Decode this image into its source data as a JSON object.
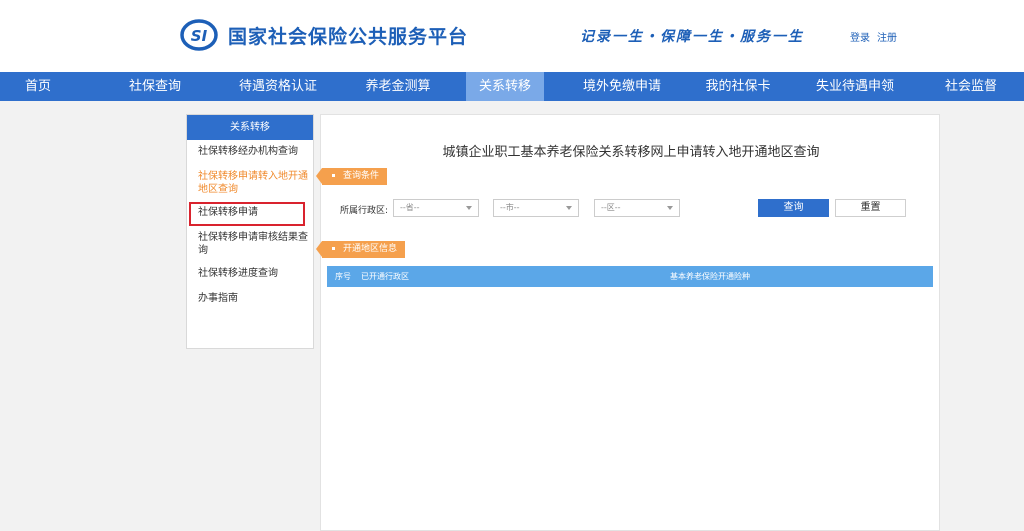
{
  "header": {
    "logo_text": "SI",
    "site_title": "国家社会保险公共服务平台",
    "slogan": "记录一生・保障一生・服务一生",
    "login": "登录",
    "register": "注册"
  },
  "nav": {
    "items": [
      {
        "label": "首页"
      },
      {
        "label": "社保查询"
      },
      {
        "label": "待遇资格认证"
      },
      {
        "label": "养老金测算"
      },
      {
        "label": "关系转移"
      },
      {
        "label": "境外免缴申请"
      },
      {
        "label": "我的社保卡"
      },
      {
        "label": "失业待遇申领"
      },
      {
        "label": "社会监督"
      }
    ],
    "active": "关系转移"
  },
  "sidebar": {
    "title": "关系转移",
    "items": [
      {
        "label": "社保转移经办机构查询"
      },
      {
        "label": "社保转移申请转入地开通地区查询"
      },
      {
        "label": "社保转移申请"
      },
      {
        "label": "社保转移申请审核结果查询"
      },
      {
        "label": "社保转移进度查询"
      },
      {
        "label": "办事指南"
      }
    ]
  },
  "main": {
    "title": "城镇企业职工基本养老保险关系转移网上申请转入地开通地区查询",
    "query_section": "查询条件",
    "region_label": "所属行政区:",
    "province_placeholder": "--省--",
    "city_placeholder": "--市--",
    "district_placeholder": "--区--",
    "query_button": "查询",
    "reset_button": "重置",
    "result_section": "开通地区信息",
    "table": {
      "columns": [
        "序号",
        "已开通行政区",
        "基本养老保险开通险种"
      ]
    }
  },
  "colors": {
    "primary": "#2f6fcc",
    "nav_active": "#7aa9e8",
    "accent_orange": "#f5a04d",
    "table_header": "#5ba7e8",
    "highlight_red": "#d9232e"
  }
}
